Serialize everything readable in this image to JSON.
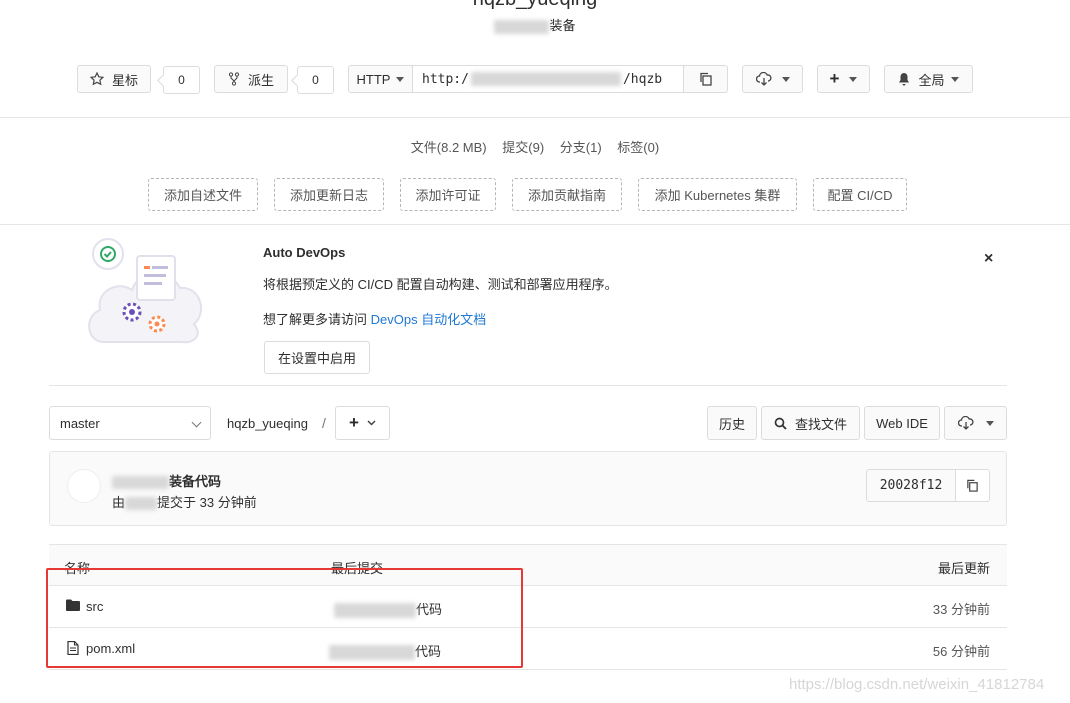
{
  "project": {
    "name": "hqzb_yueqing",
    "description_suffix": "装备"
  },
  "toolbar": {
    "star_label": "星标",
    "star_count": "0",
    "fork_label": "派生",
    "fork_count": "0",
    "protocol": "HTTP",
    "clone_url_start": "http:/",
    "clone_url_end": "/hqzb",
    "global_label": "全局"
  },
  "stats": {
    "files": "文件(8.2 MB)",
    "commits": "提交(9)",
    "branches": "分支(1)",
    "tags": "标签(0)"
  },
  "quick_actions": [
    "添加自述文件",
    "添加更新日志",
    "添加许可证",
    "添加贡献指南",
    "添加 Kubernetes 集群",
    "配置 CI/CD"
  ],
  "devops": {
    "title": "Auto DevOps",
    "description": "将根据预定义的 CI/CD 配置自动构建、测试和部署应用程序。",
    "more_prefix": "想了解更多请访问 ",
    "more_link": "DevOps 自动化文档",
    "enable_button": "在设置中启用",
    "close": "×"
  },
  "repo_bar": {
    "branch": "master",
    "path": "hqzb_yueqing",
    "separator": "/",
    "add": "+",
    "history": "历史",
    "find_file": "查找文件",
    "web_ide": "Web IDE"
  },
  "last_commit": {
    "message_suffix": "装备代码",
    "by_prefix": "由",
    "by_suffix": "提交于 33 分钟前",
    "sha": "20028f12"
  },
  "table": {
    "headers": {
      "name": "名称",
      "last_commit": "最后提交",
      "last_update": "最后更新"
    },
    "rows": [
      {
        "name": "src",
        "type": "folder-icon",
        "commit_suffix": "代码",
        "updated": "33 分钟前"
      },
      {
        "name": "pom.xml",
        "type": "file-icon",
        "commit_suffix": "代码",
        "updated": "56 分钟前"
      }
    ]
  },
  "watermark": "https://blog.csdn.net/weixin_41812784",
  "colors": {
    "link": "#1f78d1",
    "highlight_border": "#e53935"
  }
}
